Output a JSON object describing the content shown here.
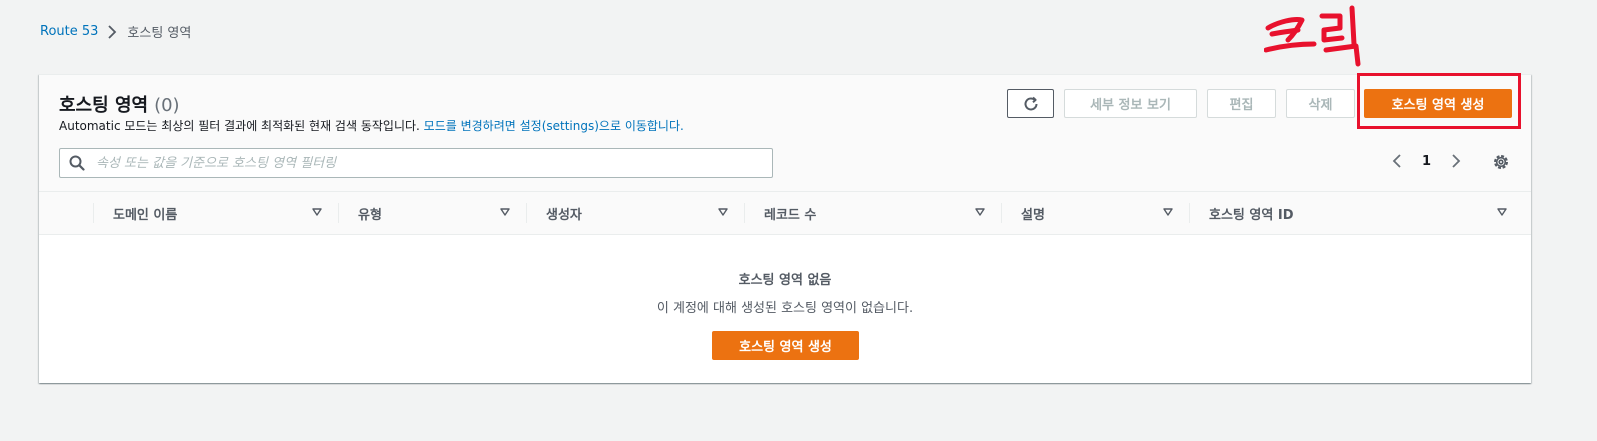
{
  "breadcrumb": {
    "root": "Route 53",
    "current": "호스팅 영역"
  },
  "annotation": {
    "handwritten_text": "클릭",
    "color": "#e8112d"
  },
  "panel": {
    "title": "호스팅 영역",
    "count": "(0)",
    "description_prefix": "Automatic 모드는 최상의 필터 결과에 최적화된 현재 검색 동작입니다.",
    "description_link": "모드를 변경하려면 설정(settings)으로 이동합니다."
  },
  "toolbar": {
    "refresh_icon": "refresh-icon",
    "details_label": "세부 정보 보기",
    "edit_label": "편집",
    "delete_label": "삭제",
    "create_label": "호스팅 영역 생성"
  },
  "search": {
    "placeholder": "속성 또는 값을 기준으로 호스팅 영역 필터링",
    "value": ""
  },
  "pagination": {
    "current_page": "1"
  },
  "table": {
    "columns": [
      {
        "label": "도메인 이름"
      },
      {
        "label": "유형"
      },
      {
        "label": "생성자"
      },
      {
        "label": "레코드 수"
      },
      {
        "label": "설명"
      },
      {
        "label": "호스팅 영역 ID"
      }
    ]
  },
  "empty_state": {
    "title": "호스팅 영역 없음",
    "description": "이 계정에 대해 생성된 호스팅 영역이 없습니다.",
    "button_label": "호스팅 영역 생성"
  },
  "colors": {
    "accent_orange": "#ec7211",
    "link_blue": "#0073bb",
    "annotation_red": "#e8112d"
  }
}
